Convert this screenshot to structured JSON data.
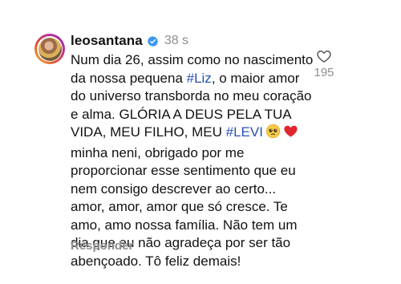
{
  "comment": {
    "username": "leosantana",
    "timestamp": "38 s",
    "lines": [
      [
        {
          "t": "Num dia 26, assim como no nascimento"
        }
      ],
      [
        {
          "t": "da nossa pequena "
        },
        {
          "t": "#Liz",
          "tag": true
        },
        {
          "t": ", o maior amor"
        }
      ],
      [
        {
          "t": "do universo transborda no meu coração"
        }
      ],
      [
        {
          "t": "e alma. GLÓRIA A DEUS PELA TUA"
        }
      ],
      [
        {
          "t": "VIDA, MEU FILHO, MEU "
        },
        {
          "t": "#LEVI",
          "tag": true
        },
        {
          "e": "pleading-face-emoji"
        },
        {
          "e": "red-heart-emoji"
        }
      ],
      [
        {
          "t": "minha neni, obrigado por me"
        }
      ],
      [
        {
          "t": "proporcionar esse sentimento que eu"
        }
      ],
      [
        {
          "t": "nem consigo descrever ao certo..."
        }
      ],
      [
        {
          "t": "amor, amor, amor que só cresce. Te"
        }
      ],
      [
        {
          "t": "amo, amo nossa família. Não tem um"
        }
      ],
      [
        {
          "t": "dia que eu não agradeça por ser tão"
        }
      ],
      [
        {
          "t": "abençoado. Tô feliz demais!"
        }
      ]
    ],
    "reply_label": "Responder",
    "like_count": "195"
  },
  "icons": {
    "verified": "verified-badge-icon",
    "like": "heart-outline-icon",
    "avatar": "avatar"
  },
  "colors": {
    "hashtag": "#2a4fb0",
    "secondary_text": "#8e8e8e",
    "verified": "#3897f0",
    "heart_emoji": "#e0262f"
  }
}
